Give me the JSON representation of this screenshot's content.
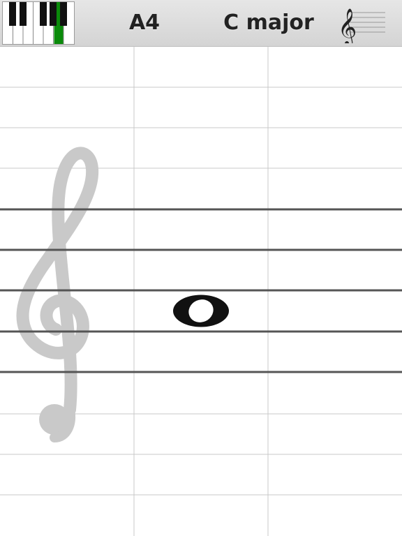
{
  "header": {
    "note_label": "A4",
    "key_label": "C major",
    "piano_icon": "piano-keyboard-icon",
    "clef_icon": "treble-clef-icon",
    "highlight_color": "#0a8a0a"
  },
  "staff": {
    "clef": "treble",
    "note": {
      "pitch": "A4",
      "type": "whole"
    }
  },
  "colors": {
    "staff_line": "#555555",
    "grid_line": "#c8c8c8",
    "background_clef": "#c9c9c9",
    "note": "#111111"
  }
}
